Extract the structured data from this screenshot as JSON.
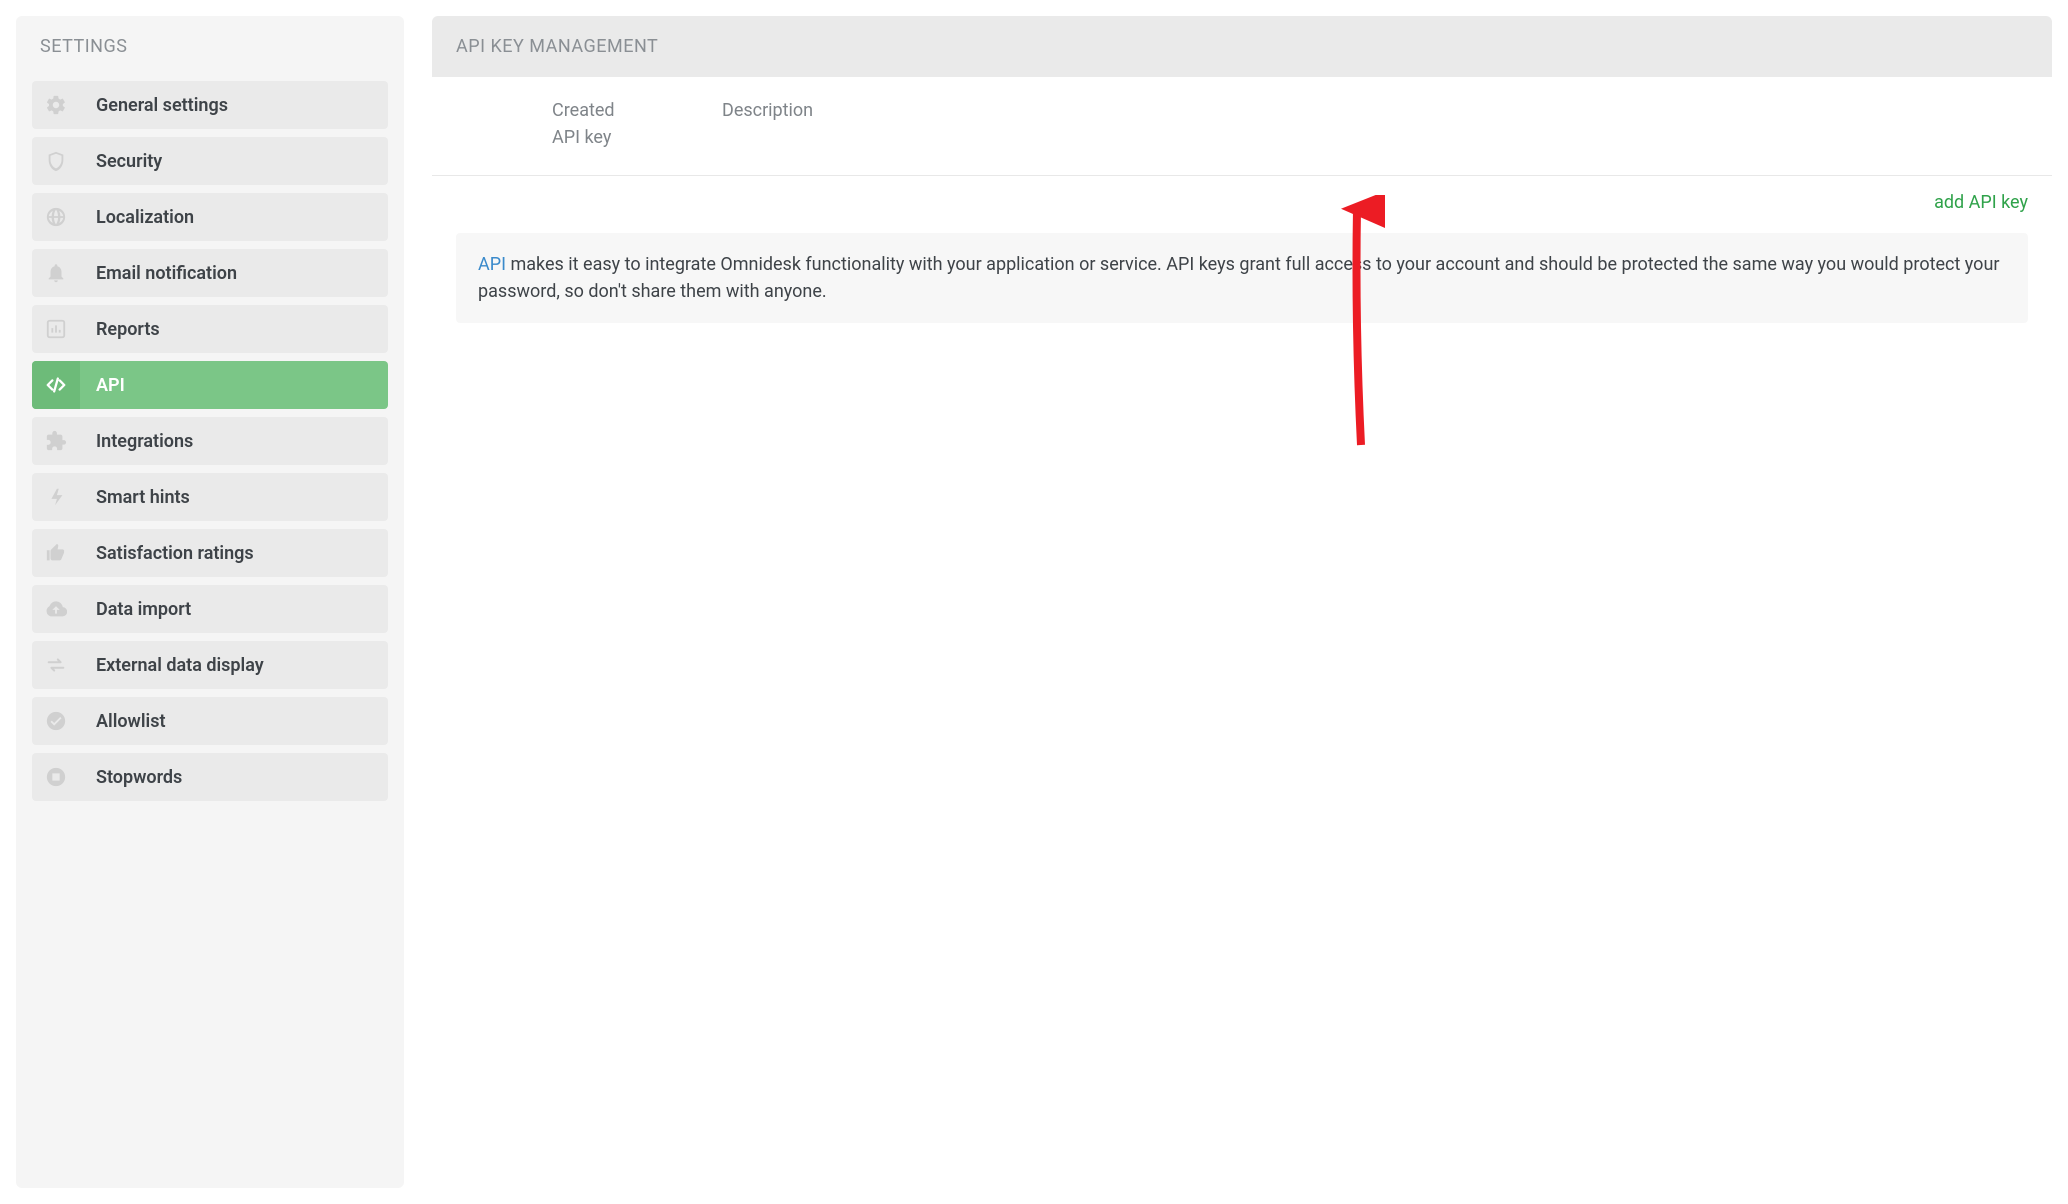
{
  "sidebar": {
    "title": "SETTINGS",
    "items": [
      {
        "id": "general",
        "label": "General settings",
        "icon": "gears-icon",
        "active": false
      },
      {
        "id": "security",
        "label": "Security",
        "icon": "shield-icon",
        "active": false
      },
      {
        "id": "localization",
        "label": "Localization",
        "icon": "globe-icon",
        "active": false
      },
      {
        "id": "email",
        "label": "Email notification",
        "icon": "bell-icon",
        "active": false
      },
      {
        "id": "reports",
        "label": "Reports",
        "icon": "bar-chart-icon",
        "active": false
      },
      {
        "id": "api",
        "label": "API",
        "icon": "code-icon",
        "active": true
      },
      {
        "id": "integrations",
        "label": "Integrations",
        "icon": "puzzle-icon",
        "active": false
      },
      {
        "id": "smart-hints",
        "label": "Smart hints",
        "icon": "bolt-icon",
        "active": false
      },
      {
        "id": "satisfaction",
        "label": "Satisfaction ratings",
        "icon": "thumbs-up-icon",
        "active": false
      },
      {
        "id": "data-import",
        "label": "Data import",
        "icon": "cloud-upload-icon",
        "active": false
      },
      {
        "id": "external",
        "label": "External data display",
        "icon": "swap-icon",
        "active": false
      },
      {
        "id": "allowlist",
        "label": "Allowlist",
        "icon": "check-circle-icon",
        "active": false
      },
      {
        "id": "stopwords",
        "label": "Stopwords",
        "icon": "stop-icon",
        "active": false
      }
    ]
  },
  "main": {
    "title": "API KEY MANAGEMENT",
    "columns": {
      "created": "Created",
      "apikey": "API key",
      "description": "Description"
    },
    "add_key_label": "add API key",
    "info_link_text": "API",
    "info_text_rest": " makes it easy to integrate Omnidesk functionality with your application or service. API keys grant full access to your account and should be protected the same way you would protect your password, so don't share them with anyone."
  },
  "annotation": {
    "type": "arrow",
    "color": "#ec1c24"
  }
}
